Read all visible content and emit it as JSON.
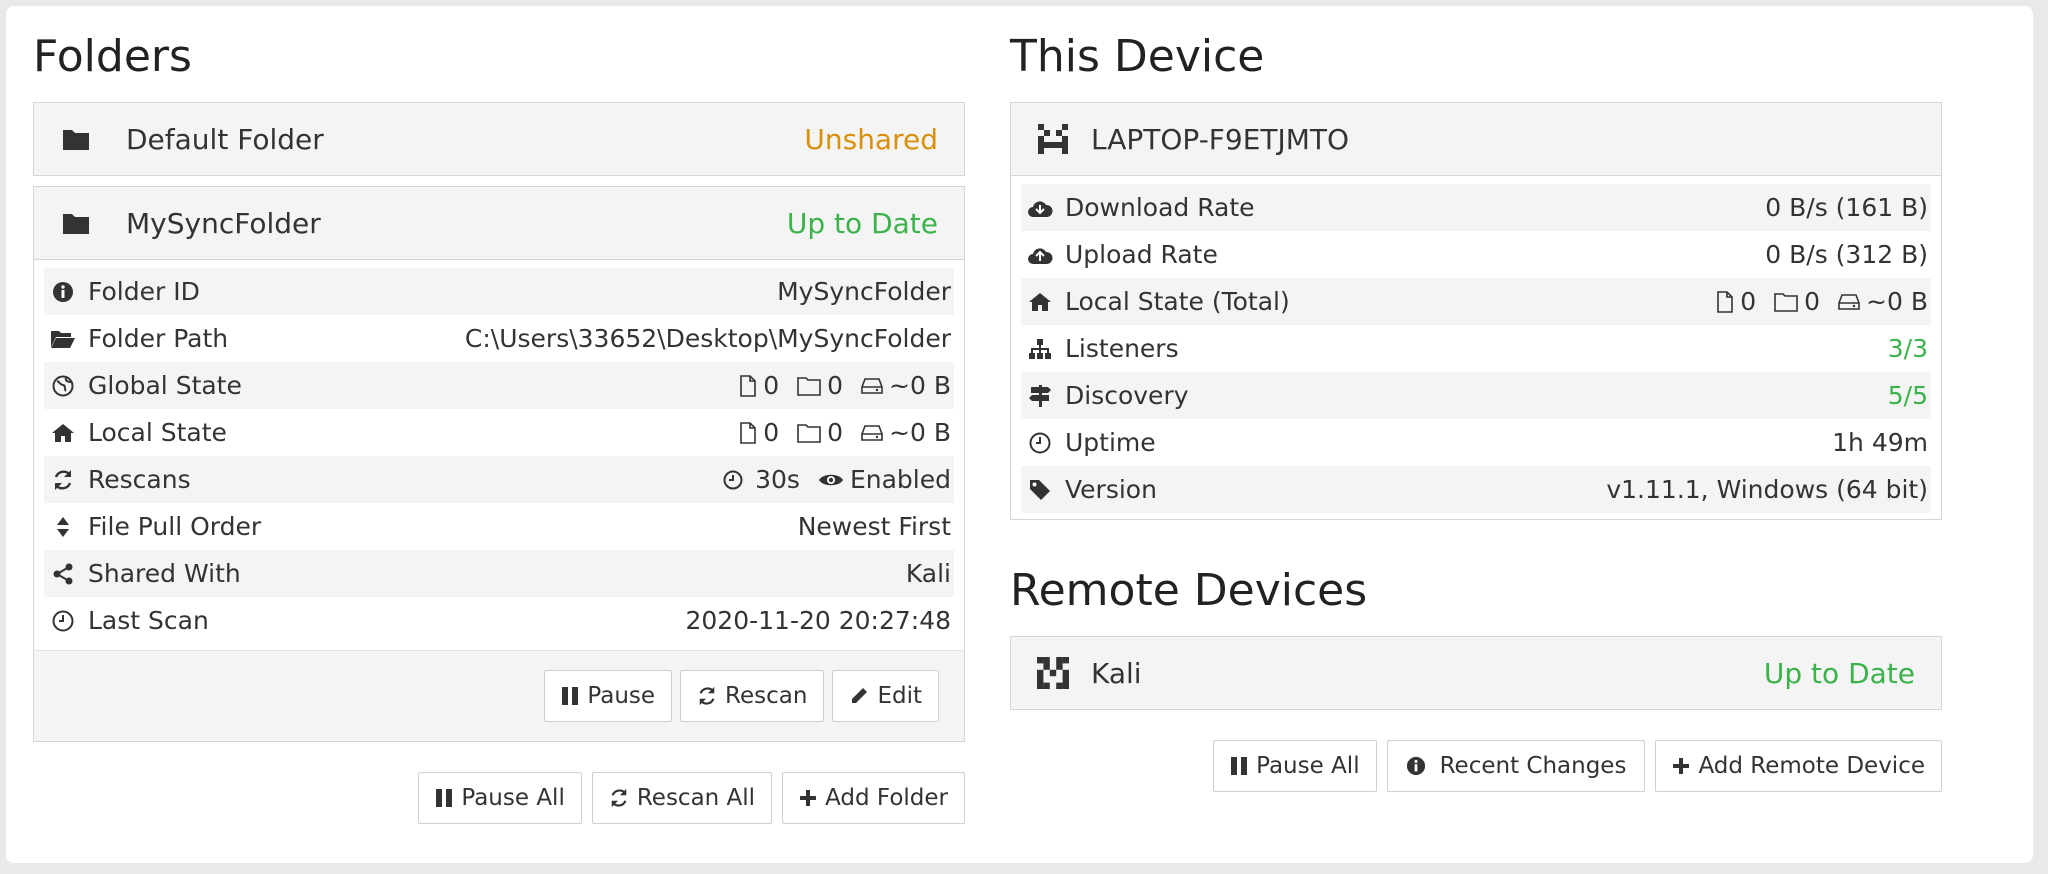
{
  "folders": {
    "heading": "Folders",
    "items": [
      {
        "name": "Default Folder",
        "status": "Unshared"
      },
      {
        "name": "MySyncFolder",
        "status": "Up to Date"
      }
    ],
    "details": {
      "folder_id": {
        "label": "Folder ID",
        "value": "MySyncFolder"
      },
      "folder_path": {
        "label": "Folder Path",
        "value": "C:\\Users\\33652\\Desktop\\MySyncFolder"
      },
      "global_state": {
        "label": "Global State",
        "files": "0",
        "dirs": "0",
        "size": "~0 B"
      },
      "local_state": {
        "label": "Local State",
        "files": "0",
        "dirs": "0",
        "size": "~0 B"
      },
      "rescans": {
        "label": "Rescans",
        "interval": "30s",
        "watch": "Enabled"
      },
      "pull_order": {
        "label": "File Pull Order",
        "value": "Newest First"
      },
      "shared_with": {
        "label": "Shared With",
        "value": "Kali"
      },
      "last_scan": {
        "label": "Last Scan",
        "value": "2020-11-20 20:27:48"
      }
    },
    "folder_buttons": {
      "pause": "Pause",
      "rescan": "Rescan",
      "edit": "Edit"
    },
    "actions": {
      "pause_all": "Pause All",
      "rescan_all": "Rescan All",
      "add_folder": "Add Folder"
    }
  },
  "this_device": {
    "heading": "This Device",
    "name": "LAPTOP-F9ETJMTO",
    "download": {
      "label": "Download Rate",
      "value": "0 B/s (161 B)"
    },
    "upload": {
      "label": "Upload Rate",
      "value": "0 B/s (312 B)"
    },
    "local_total": {
      "label": "Local State (Total)",
      "files": "0",
      "dirs": "0",
      "size": "~0 B"
    },
    "listeners": {
      "label": "Listeners",
      "value": "3/3"
    },
    "discovery": {
      "label": "Discovery",
      "value": "5/5"
    },
    "uptime": {
      "label": "Uptime",
      "value": "1h 49m"
    },
    "version": {
      "label": "Version",
      "value": "v1.11.1, Windows (64 bit)"
    }
  },
  "remote_devices": {
    "heading": "Remote Devices",
    "items": [
      {
        "name": "Kali",
        "status": "Up to Date"
      }
    ],
    "actions": {
      "pause_all": "Pause All",
      "recent_changes": "Recent Changes",
      "add_remote": "Add Remote Device"
    }
  },
  "colors": {
    "unshared": "#d9900b",
    "up_to_date": "#3bb34a"
  }
}
